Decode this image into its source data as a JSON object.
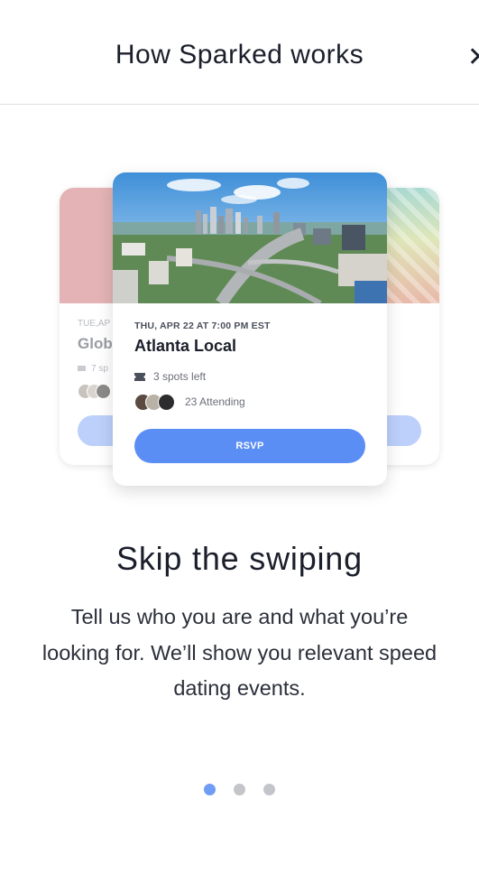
{
  "header": {
    "title": "How Sparked works",
    "close_label": "✕"
  },
  "cards": {
    "back_left": {
      "date": "TUE,AP",
      "title": "Glob",
      "spots": "7 sp",
      "image_color": "#e3b3b5"
    },
    "front": {
      "date": "THU, APR 22 AT 7:00 PM EST",
      "title": "Atlanta Local",
      "spots": "3 spots left",
      "attending": "23 Attending",
      "rsvp_label": "RSVP",
      "image_description": "Atlanta skyline"
    }
  },
  "onboarding": {
    "headline": "Skip the swiping",
    "description": "Tell us who you are and what you’re looking for. We’ll show you relevant speed dating events.",
    "page_count": 3,
    "active_page": 1
  },
  "colors": {
    "accent": "#5b8ef5",
    "accent_light": "#bcd0fb",
    "dot_active": "#6f9cf5",
    "dot_inactive": "#c3c5ca",
    "text": "#1b1f2b"
  }
}
